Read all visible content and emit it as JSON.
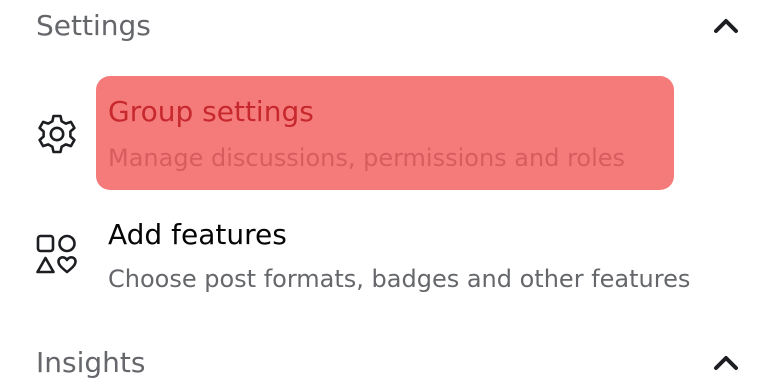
{
  "sections": {
    "settings": {
      "title": "Settings",
      "icon": "chevron-up-icon"
    },
    "insights": {
      "title": "Insights",
      "icon": "chevron-up-icon"
    }
  },
  "items": [
    {
      "title": "Group settings",
      "description": "Manage discussions, permissions and roles",
      "icon": "gear-icon",
      "highlighted": true
    },
    {
      "title": "Add features",
      "description": "Choose post formats, badges and other features",
      "icon": "shapes-icon",
      "highlighted": false
    }
  ],
  "colors": {
    "highlight": "#f57b7b",
    "highlight_title": "#c6282d",
    "highlight_desc": "#d85c5e",
    "title": "#050505",
    "description": "#65676b",
    "section_title": "#65676b"
  }
}
